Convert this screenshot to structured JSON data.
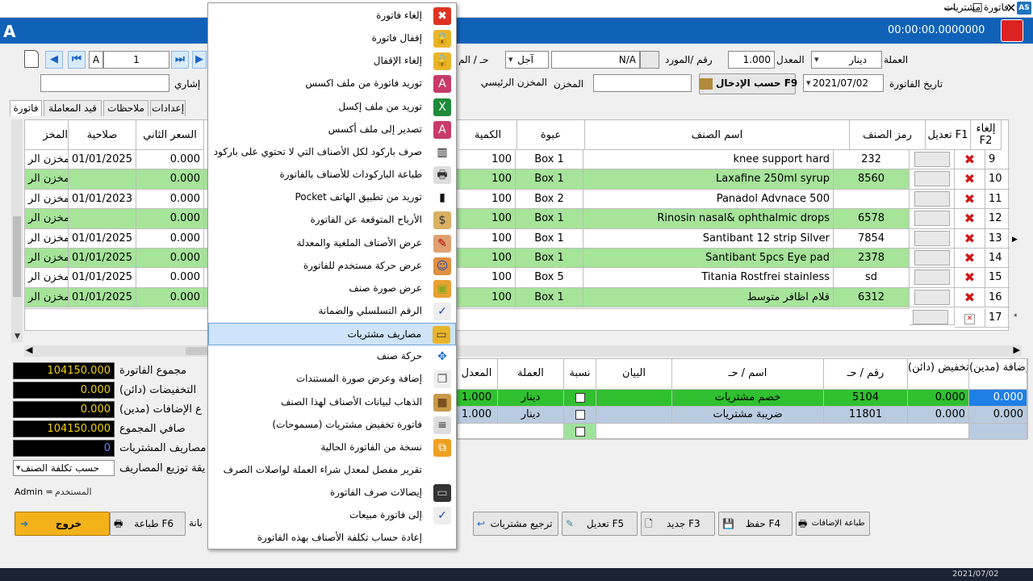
{
  "window": {
    "title": "فاتورة مشتريات",
    "app_icon": "AS",
    "min": "—",
    "max": "☐",
    "close": "✕"
  },
  "header": {
    "timer": "00:00:00.0000000"
  },
  "form": {
    "currency_label": "العملة",
    "currency_value": "دينار",
    "rate_label": "المعدل",
    "rate_value": "1.000",
    "supplier_label": "رقم /المورد",
    "supplier_value": "N/A",
    "payment_value": "آجل",
    "account_label": "حـ / الم",
    "invoice_date_label": "تاريخ الفاتورة",
    "invoice_date_value": "2021/07/02",
    "entry_btn": "حسب الإدخال F9",
    "warehouse_label": "المخزن",
    "warehouse_value": "المخزن الرئيسي",
    "notice_label": "إشاري",
    "nav_letter": "A",
    "nav_number": "1"
  },
  "tabs": [
    "فاتورة",
    "قيد المعاملة",
    "ملاحظات",
    "إعدادات"
  ],
  "grid": {
    "headers": {
      "cancel": "إلغاء F2",
      "edit": "تعديل F1",
      "code": "رمز الصنف",
      "name": "اسم الصنف",
      "pack": "عبوة",
      "qty": "الكمية",
      "price2": "السعر الثاني",
      "expiry": "صلاحية",
      "store": "المخز"
    },
    "rows": [
      {
        "n": "9",
        "code": "232",
        "name": "knee support hard",
        "pack": "Box 1",
        "qty": "100",
        "price2": "0.000",
        "expiry": "01/01/2025",
        "store": "المخزن الر",
        "green": false
      },
      {
        "n": "10",
        "code": "8560",
        "name": "Laxafine 250ml syrup",
        "pack": "Box 1",
        "qty": "100",
        "price2": "0.000",
        "expiry": "",
        "store": "المخزن الر",
        "green": true
      },
      {
        "n": "11",
        "code": "",
        "name": "Panadol Advnace 500",
        "pack": "Box 2",
        "qty": "100",
        "price2": "0.000",
        "expiry": "01/01/2023",
        "store": "المخزن الر",
        "green": false
      },
      {
        "n": "12",
        "code": "6578",
        "name": "Rinosin nasal& ophthalmic drops",
        "pack": "Box 1",
        "qty": "100",
        "price2": "0.000",
        "expiry": "",
        "store": "المخزن الر",
        "green": true
      },
      {
        "n": "13",
        "code": "7854",
        "name": "Santibant 12 strip Silver",
        "pack": "Box 1",
        "qty": "100",
        "price2": "0.000",
        "expiry": "01/01/2025",
        "store": "المخزن الر",
        "green": false
      },
      {
        "n": "14",
        "code": "2378",
        "name": "Santibant 5pcs Eye pad",
        "pack": "Box 1",
        "qty": "100",
        "price2": "0.000",
        "expiry": "01/01/2025",
        "store": "المخزن الر",
        "green": true
      },
      {
        "n": "15",
        "code": "sd",
        "name": "Titania Rostfrei stainless",
        "pack": "Box 5",
        "qty": "100",
        "price2": "0.000",
        "expiry": "01/01/2025",
        "store": "المخزن الر",
        "green": false
      },
      {
        "n": "16",
        "code": "6312",
        "name": "قلام اظافر متوسط",
        "pack": "Box 1",
        "qty": "100",
        "price2": "0.000",
        "expiry": "01/01/2025",
        "store": "المخزن الر",
        "green": true
      }
    ],
    "new_row_n": "17"
  },
  "context_menu": [
    {
      "label": "إلغاء فاتورة",
      "icon": "cancel-icon"
    },
    {
      "label": "إقفال فاتورة",
      "icon": "lock-icon"
    },
    {
      "label": "إلغاء الإقفال",
      "icon": "unlock-icon"
    },
    {
      "label": "توريد فاتورة من ملف اكسس",
      "icon": "access-import-icon"
    },
    {
      "label": "توريد من ملف إكسل",
      "icon": "excel-icon"
    },
    {
      "label": "تصدير إلى ملف أكسس",
      "icon": "access-export-icon"
    },
    {
      "label": "صرف باركود لكل الأصناف التي لا تحتوي على باركود",
      "icon": "barcode-icon"
    },
    {
      "label": "طباعة الباركودات  للأصناف بالفاتورة",
      "icon": "printer-icon"
    },
    {
      "label": "توريد من تطبيق الهاتف  Pocket",
      "icon": "phone-icon"
    },
    {
      "label": "الأرباح المتوقعة عن الفاتورة",
      "icon": "money-bag-icon"
    },
    {
      "label": "عرض الأصناف الملغية والمعدلة",
      "icon": "edit-cancel-icon"
    },
    {
      "label": "عرض حركة مستخدم للفاتورة",
      "icon": "users-icon"
    },
    {
      "label": "عرض صورة صنف",
      "icon": "image-icon"
    },
    {
      "label": "الرقم التسلسلي والضمانة",
      "icon": "checklist-icon"
    },
    {
      "label": "مصاريف مشتريات",
      "icon": "expense-icon"
    },
    {
      "label": "حركة صنف",
      "icon": "move-icon"
    },
    {
      "label": "إضافة وعرض صورة المستندات",
      "icon": "documents-icon"
    },
    {
      "label": "الذهاب لبيانات الأصناف لهذا الصنف",
      "icon": "box-icon"
    },
    {
      "label": "فاتورة تخفيض مشتريات (مسموحات)",
      "icon": "invoice-icon"
    },
    {
      "label": "نسخة من الفاتورة الحالية",
      "icon": "copy-icon"
    },
    {
      "label": "تقرير مفصل لمعدل شراء العملة لواصلات الصرف",
      "icon": "report-icon"
    },
    {
      "label": "إيصالات صرف الفاتورة",
      "icon": "wallet-icon"
    },
    {
      "label": "إلى فاتورة مبيعات",
      "icon": "checklist-icon"
    },
    {
      "label": "إعادة حساب تكلفة الأصناف بهذه الفاتورة",
      "icon": "recalc-icon"
    }
  ],
  "summary": {
    "total_label": "مجموع الفاتورة",
    "total_value": "104150.000",
    "disc_label": "التخفيضات (دائن)",
    "disc_value": "0.000",
    "add_label": "ع الإضافات (مدين)",
    "add_value": "0.000",
    "net_label": "صافي المجموع",
    "net_value": "104150.000",
    "exp_label": "مصاريف المشتريات",
    "exp_value": "0",
    "dist_label": "يقة توزيع المصاريف",
    "dist_value": "حسب تكلفة الصنف",
    "user_label": "المستخدم",
    "user_value": "Admin ="
  },
  "adj_grid": {
    "headers": {
      "add": "(مدين) إضافة",
      "disc": "(دائن) تخفيض",
      "acc_no": "رقم / حـ",
      "acc_name": "اسم / حـ",
      "desc": "البيان",
      "ratio": "نسبة",
      "cur": "العملة",
      "rate": "المعدل"
    },
    "rows": [
      {
        "add": "0.000",
        "disc": "0.000",
        "acc_no": "5104",
        "acc_name": "خصم مشتريات",
        "cur": "دينار",
        "rate": "1.000"
      },
      {
        "add": "0.000",
        "disc": "0.000",
        "acc_no": "11801",
        "acc_name": "ضريبة مشتريات",
        "cur": "دينار",
        "rate": "1.000"
      }
    ]
  },
  "bottom_buttons": {
    "exit": "خروج",
    "print": "طباعة F6",
    "print_cut": "بانة",
    "return": "ترجيع مشتريات",
    "edit": "تعديل F5",
    "new": "جديد F3",
    "save": "حفظ F4",
    "print_adds": "طباعة الإضافات"
  },
  "taskbar": {
    "date": "2021/07/02"
  },
  "colors": {
    "blue_header": "#1062b8",
    "row_green": "#a6e49a",
    "menu_selected": "#cde4fa",
    "summary_text": "#f3d200"
  }
}
